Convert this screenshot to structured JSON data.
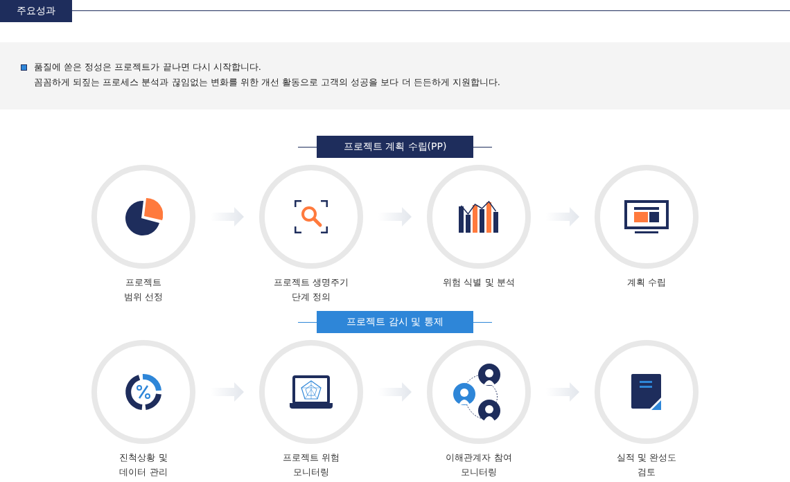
{
  "header": {
    "title": "주요성과"
  },
  "intro": {
    "lines": [
      "품질에 쏟은 정성은 프로젝트가 끝나면 다시 시작합니다.",
      "꼼꼼하게 되짚는 프로세스 분석과 끊임없는 변화를 위한 개선 활동으로 고객의 성공을 보다 더 든든하게 지원합니다."
    ]
  },
  "sections": [
    {
      "title": "프로젝트 계획 수립(PP)",
      "kind": "primary",
      "steps": [
        {
          "label_lines": [
            "프로젝트",
            "범위 선정"
          ]
        },
        {
          "label_lines": [
            "프로젝트 생명주기",
            "단계 정의"
          ]
        },
        {
          "label_lines": [
            "위험 식별 및 분석"
          ]
        },
        {
          "label_lines": [
            "계획 수립"
          ]
        }
      ]
    },
    {
      "title": "프로젝트 감시 및 통제",
      "kind": "accent",
      "steps": [
        {
          "label_lines": [
            "진척상황 및",
            "데이터 관리"
          ]
        },
        {
          "label_lines": [
            "프로젝트 위험",
            "모니터링"
          ]
        },
        {
          "label_lines": [
            "이해관계자 참여",
            "모니터링"
          ]
        },
        {
          "label_lines": [
            "실적 및 완성도",
            "검토"
          ]
        }
      ]
    }
  ]
}
